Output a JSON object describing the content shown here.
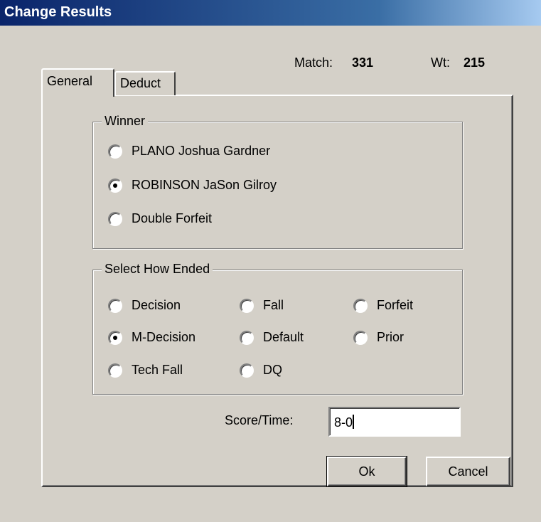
{
  "window": {
    "title": "Change Results"
  },
  "header": {
    "match_label": "Match:",
    "match_value": "331",
    "wt_label": "Wt:",
    "wt_value": "215"
  },
  "tabs": [
    {
      "label": "General",
      "selected": true
    },
    {
      "label": "Deduct",
      "selected": false
    }
  ],
  "winner": {
    "legend": "Winner",
    "options": [
      {
        "label": "PLANO Joshua Gardner",
        "checked": false
      },
      {
        "label": "ROBINSON JaSon Gilroy",
        "checked": true
      },
      {
        "label": "Double Forfeit",
        "checked": false
      }
    ]
  },
  "how_ended": {
    "legend": "Select How Ended",
    "options": [
      {
        "label": "Decision",
        "checked": false
      },
      {
        "label": "Fall",
        "checked": false
      },
      {
        "label": "Forfeit",
        "checked": false
      },
      {
        "label": "M-Decision",
        "checked": true
      },
      {
        "label": "Default",
        "checked": false
      },
      {
        "label": "Prior",
        "checked": false
      },
      {
        "label": "Tech Fall",
        "checked": false
      },
      {
        "label": "DQ",
        "checked": false
      }
    ]
  },
  "score": {
    "label": "Score/Time:",
    "value": "8-0"
  },
  "buttons": {
    "ok": "Ok",
    "cancel": "Cancel"
  }
}
